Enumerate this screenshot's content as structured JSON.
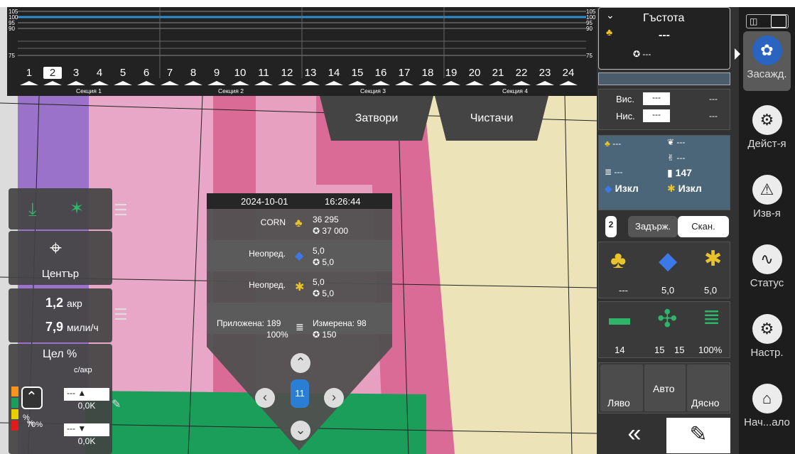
{
  "sections": {
    "numbers": [
      "1",
      "2",
      "3",
      "4",
      "5",
      "6",
      "7",
      "8",
      "9",
      "10",
      "11",
      "12",
      "13",
      "14",
      "15",
      "16",
      "17",
      "18",
      "19",
      "20",
      "21",
      "22",
      "23",
      "24"
    ],
    "selected_index": 1,
    "groups": [
      "Секция 1",
      "Секция 2",
      "Секция 3",
      "Секция 4"
    ],
    "scale_left": [
      "105",
      "100",
      "95",
      "90",
      "75"
    ],
    "scale_right": [
      "105",
      "100",
      "95",
      "90",
      "75"
    ]
  },
  "tabs": {
    "shutters": "Затвори",
    "cleaners": "Чистачи"
  },
  "left": {
    "center_label": "Център",
    "area_value": "1,2",
    "area_unit": "акр",
    "speed_value": "7,9",
    "speed_unit": "мили/ч",
    "target_title": "Цел %",
    "target_unit": "с/акр",
    "target_row1_a": "---",
    "target_row1_b": "0,0K",
    "target_row2_a": "---",
    "target_row2_b": "0,0K",
    "legend_pct1": "%",
    "legend_pct2": "%",
    "legend_pct3": "70%"
  },
  "popup": {
    "date": "2024-10-01",
    "time": "16:26:44",
    "rows": [
      {
        "label": "CORN",
        "value": "36 295",
        "sub": "37 000"
      },
      {
        "label": "Неопред.",
        "value": "5,0",
        "sub": "5,0"
      },
      {
        "label": "Неопред.",
        "value": "5,0",
        "sub": "5,0"
      }
    ],
    "applied_label": "Приложена: 189",
    "applied_pct": "100%",
    "measured_label": "Измерена: 98",
    "measured_sub": "150",
    "tractor_number": "11"
  },
  "right": {
    "density_title": "Гъстота",
    "density_value": "---",
    "density_sub": "---",
    "high_label": "Вис.",
    "high_box": "---",
    "high_val": "---",
    "low_label": "Нис.",
    "low_box": "---",
    "low_val": "---",
    "grid_a": "---",
    "grid_b": "---",
    "grid_c": "---",
    "grid_d": "---",
    "grid_e": "147",
    "grid_f": "Изкл",
    "grid_g": "Изкл",
    "hold_label": "Задърж.",
    "scan_label": "Скан.",
    "badge": "2",
    "icons_row1": [
      "---",
      "5,0",
      "5,0"
    ],
    "icons_row2": [
      "14",
      "15",
      "15",
      "100%"
    ],
    "left_btn": "Ляво",
    "auto_btn": "Авто",
    "right_btn": "Дясно"
  },
  "rail": {
    "items": [
      "Засажд.",
      "Дейст-я",
      "Изв-я",
      "Статус",
      "Настр.",
      "Нач...ало"
    ]
  },
  "colors": {
    "accent": "#1a9e5a",
    "selected_rail": "#5a5a5a",
    "water": "#2850c8"
  }
}
